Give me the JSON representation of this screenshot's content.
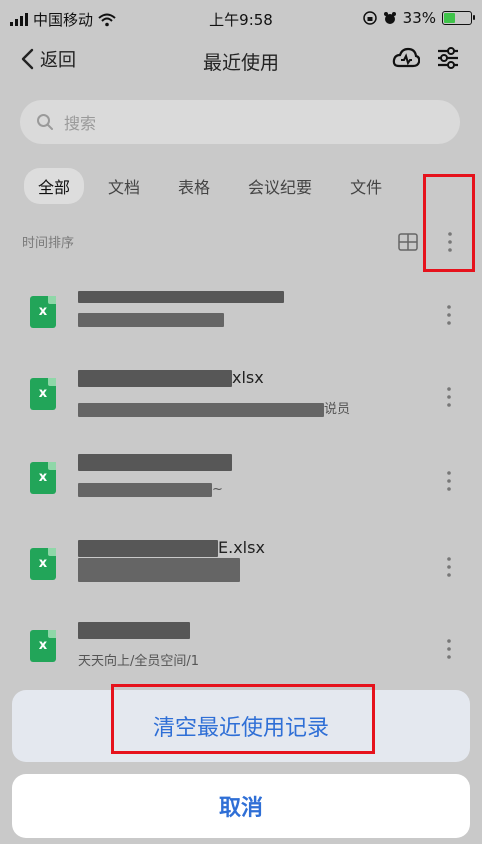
{
  "status_bar": {
    "carrier": "中国移动",
    "time": "上午9:58",
    "battery_percent": "33%",
    "battery_level": 0.33
  },
  "nav": {
    "back_label": "返回",
    "title": "最近使用"
  },
  "search": {
    "placeholder": "搜索"
  },
  "tabs": [
    {
      "label": "全部",
      "active": true
    },
    {
      "label": "文档",
      "active": false
    },
    {
      "label": "表格",
      "active": false
    },
    {
      "label": "会议纪要",
      "active": false
    },
    {
      "label": "文件",
      "active": false
    }
  ],
  "sort_label": "时间排序",
  "files": [
    {
      "icon": "excel-file-icon",
      "title_visible": "",
      "subtitle_visible": ""
    },
    {
      "icon": "excel-file-icon",
      "title_visible": "xlsx",
      "subtitle_visible": "说员"
    },
    {
      "icon": "excel-file-icon",
      "title_visible": "",
      "subtitle_visible": "~"
    },
    {
      "icon": "excel-file-icon",
      "title_visible": "E.xlsx",
      "subtitle_visible": ""
    },
    {
      "icon": "excel-file-icon",
      "title_visible": "",
      "subtitle_visible": "天天向上/全员空间/1"
    }
  ],
  "action_sheet": {
    "clear_label": "清空最近使用记录",
    "cancel_label": "取消"
  },
  "colors": {
    "accent": "#2f6fd6",
    "excel_green": "#22a559",
    "highlight_red": "#e6121c"
  }
}
